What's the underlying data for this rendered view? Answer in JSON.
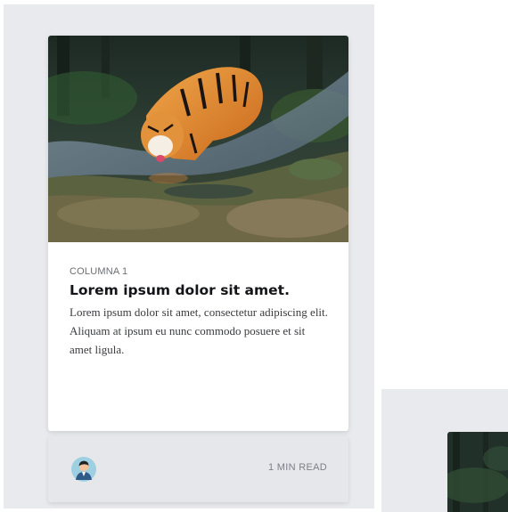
{
  "card": {
    "image_icon": "tiger-photo",
    "category": "COLUMNA 1",
    "title": "Lorem ipsum dolor sit amet.",
    "description": "Lorem ipsum dolor sit amet, consectetur adipiscing elit. Aliquam at ipsum eu nunc commodo posuere et sit amet ligula.",
    "footer": {
      "avatar_icon": "user-avatar-icon",
      "read_time": "1 MIN READ"
    }
  },
  "second_card": {
    "image_icon": "tiger-photo"
  },
  "colors": {
    "panel_bg": "#e9eaee",
    "card_bg": "#ffffff",
    "footer_bg": "#e6e7eb",
    "title": "#141518",
    "muted": "#6b6e73"
  }
}
